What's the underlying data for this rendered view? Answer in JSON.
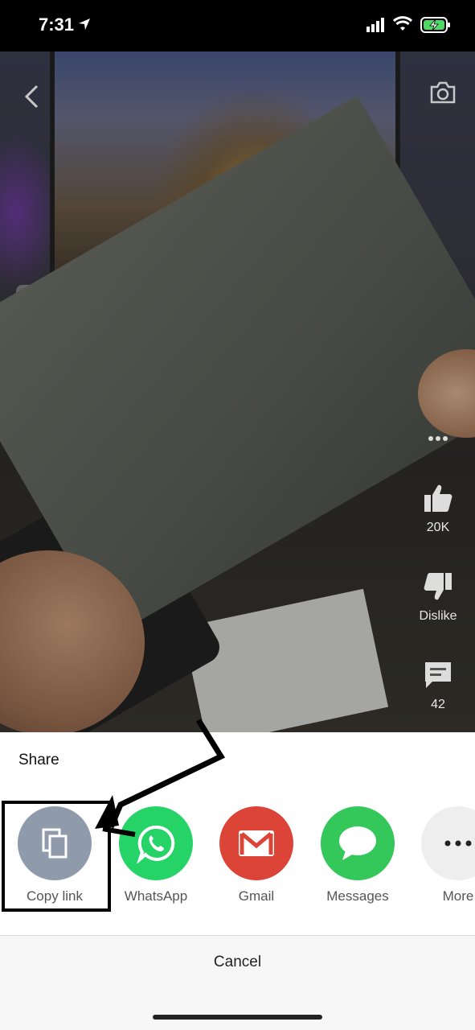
{
  "status_bar": {
    "time": "7:31"
  },
  "video": {
    "actions": {
      "more_icon": "more-dots-icon",
      "like_count": "20K",
      "dislike_label": "Dislike",
      "comment_count": "42"
    }
  },
  "share_sheet": {
    "title": "Share",
    "items": [
      {
        "label": "Copy link",
        "icon": "copy-icon",
        "color": "#8f9aab"
      },
      {
        "label": "WhatsApp",
        "icon": "whatsapp-icon",
        "color": "#25d366"
      },
      {
        "label": "Gmail",
        "icon": "gmail-icon",
        "color": "#db4437"
      },
      {
        "label": "Messages",
        "icon": "messages-icon",
        "color": "#34c759"
      },
      {
        "label": "More",
        "icon": "more-icon",
        "color": "#eeeeee"
      }
    ],
    "cancel_label": "Cancel"
  }
}
